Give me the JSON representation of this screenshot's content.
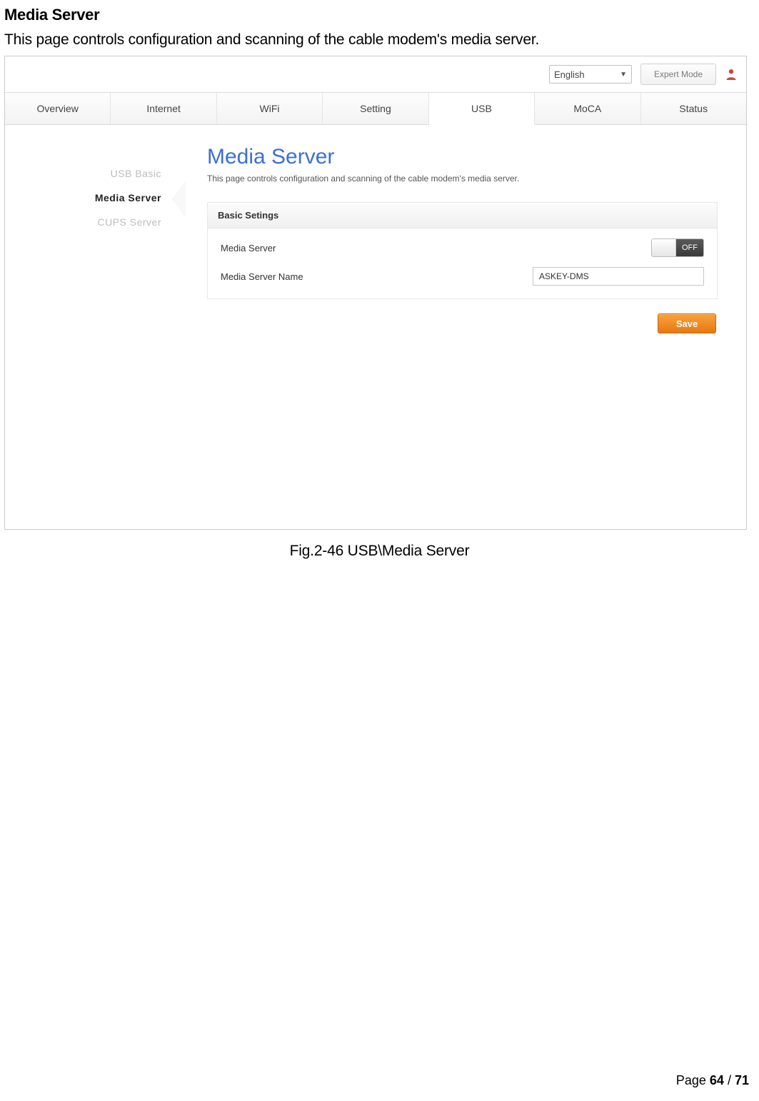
{
  "doc": {
    "title": "Media Server",
    "desc": "This page controls configuration and scanning of the cable modem's media server.",
    "figure_caption": "Fig.2-46 USB\\Media Server",
    "page_label_prefix": "Page ",
    "page_current": "64",
    "page_sep": " / ",
    "page_total": "71"
  },
  "topbar": {
    "language": "English",
    "expert_mode": "Expert Mode"
  },
  "nav": {
    "tabs": [
      "Overview",
      "Internet",
      "WiFi",
      "Setting",
      "USB",
      "MoCA",
      "Status"
    ],
    "active_index": 4
  },
  "sidenav": {
    "items": [
      "USB Basic",
      "Media Server",
      "CUPS Server"
    ],
    "active_index": 1
  },
  "page": {
    "heading": "Media Server",
    "subheading": "This page controls configuration and scanning of the cable modem's media server."
  },
  "panel": {
    "header": "Basic Setings",
    "row_media_server_label": "Media Server",
    "toggle_state": "OFF",
    "row_name_label": "Media Server Name",
    "name_value": "ASKEY-DMS"
  },
  "buttons": {
    "save": "Save"
  }
}
